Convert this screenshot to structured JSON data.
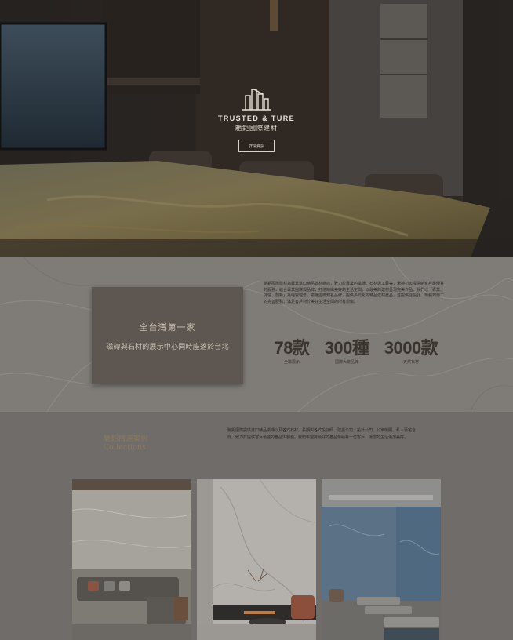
{
  "hero": {
    "brand_en": "TRUSTED & TURE",
    "brand_cn": "馳鉅國際建材",
    "button_label": "詳情資訊"
  },
  "intro": {
    "card_title": "全台灣第一家",
    "card_subtitle": "磁磚與石材的展示中心同時座落於台北",
    "description": "馳鉅國際建材為專業進口精品建材廠商，致力於專業的磁磚、石材與工藝等，秉持初衷提供給客戶最優質的服務，結合專業團隊與品牌，打造精緻美好的生活空間，以最美的建材呈現完美作品。我們以「專業、誠信、創新」為經營理念，嚴選國際知名品牌，提供多元化的精品建材產品，並提供從設計、規劃到施工的完善服務，滿足客戶對於美好生活空間的所有想像。",
    "stats": [
      {
        "value": "78款",
        "label": "全磁展示"
      },
      {
        "value": "300種",
        "label": "國際大廠品牌"
      },
      {
        "value": "3000款",
        "label": "天然石材"
      }
    ]
  },
  "collections": {
    "heading_cn": "馳鉅精選案例",
    "heading_en": "Collections",
    "description": "馳鉅國際提供進口精品磁磚以及各式石材，長期與各式設計師、建設公司、設計公司、公家機關、私人豪宅合作，致力於提供客戶最佳的產品與服務，我們希望將最好的產品帶給每一位客戶，讓您的生活更加美好。"
  },
  "colors": {
    "background": "#6f6c69",
    "card": "#5e5650",
    "accent_gold": "#8b7a5e"
  }
}
